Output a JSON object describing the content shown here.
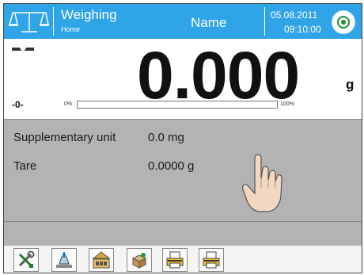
{
  "header": {
    "title": "Weighing",
    "subtitle": "Home",
    "user": "Name",
    "date": "05.08.2011",
    "time": "09:10:00",
    "accent": "#2fa4e7"
  },
  "display": {
    "weight": "0.000",
    "unit": "g",
    "zero_indicator": "-0-",
    "progress": {
      "min_label": "0%",
      "max_label": "100%",
      "value_fraction": 0
    }
  },
  "info": {
    "rows": [
      {
        "label": "Supplementary unit",
        "value": "0.0 mg"
      },
      {
        "label": "Tare",
        "value": "0.0000 g"
      }
    ]
  },
  "toolbar": {
    "buttons": [
      {
        "icon": "wrench-screwdriver-icon"
      },
      {
        "icon": "tare-icon"
      },
      {
        "icon": "product-database-icon"
      },
      {
        "icon": "packaging-icon"
      },
      {
        "icon": "printer-icon"
      },
      {
        "icon": "printer-icon"
      }
    ]
  }
}
